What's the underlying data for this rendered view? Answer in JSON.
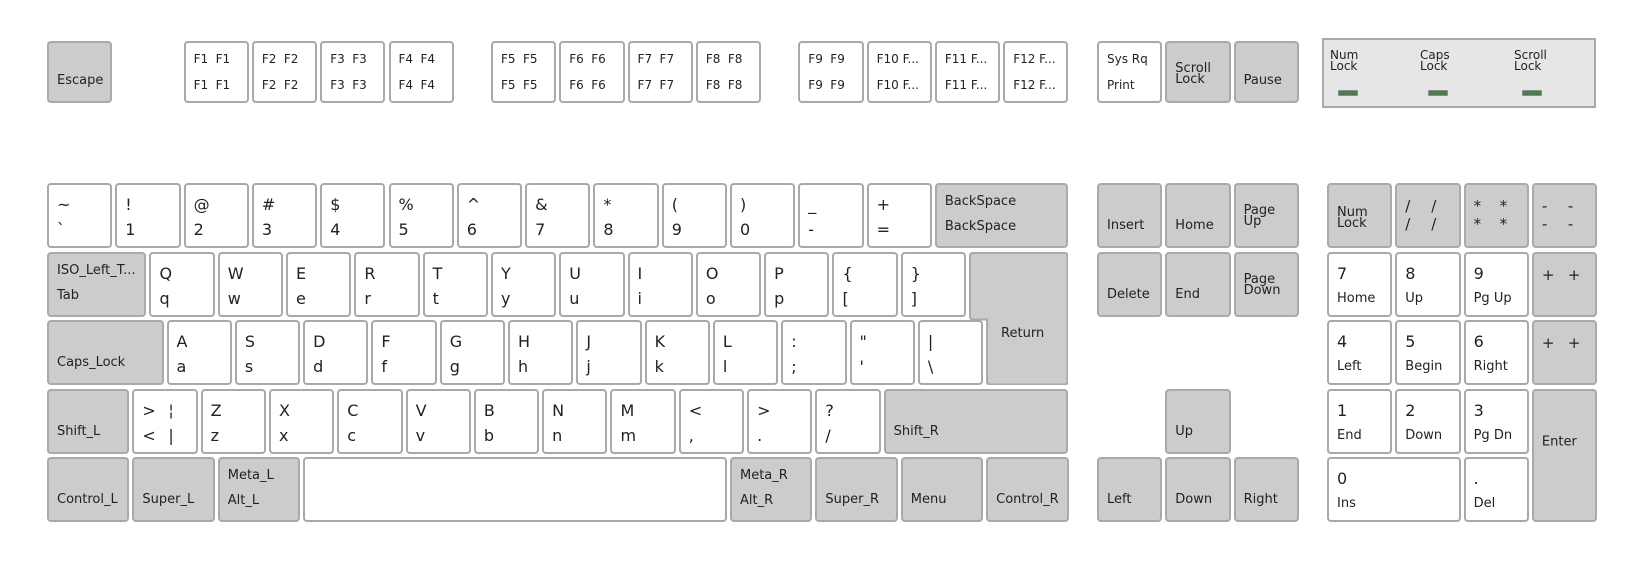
{
  "leds": [
    {
      "label": "Num\nLock",
      "state": "off",
      "color": "#4f7a4f"
    },
    {
      "label": "Caps\nLock",
      "state": "off",
      "color": "#4f7a4f"
    },
    {
      "label": "Scroll\nLock",
      "state": "off",
      "color": "#4f7a4f"
    }
  ],
  "function_row": [
    {
      "id": "escape",
      "style": "mod",
      "labels": {
        "single": "Escape"
      }
    },
    {
      "id": "f1",
      "style": "fkey",
      "labels": {
        "tl": "F1",
        "tr": "F1",
        "bl": "F1",
        "br": "F1"
      }
    },
    {
      "id": "f2",
      "style": "fkey",
      "labels": {
        "tl": "F2",
        "tr": "F2",
        "bl": "F2",
        "br": "F2"
      }
    },
    {
      "id": "f3",
      "style": "fkey",
      "labels": {
        "tl": "F3",
        "tr": "F3",
        "bl": "F3",
        "br": "F3"
      }
    },
    {
      "id": "f4",
      "style": "fkey",
      "labels": {
        "tl": "F4",
        "tr": "F4",
        "bl": "F4",
        "br": "F4"
      }
    },
    {
      "id": "f5",
      "style": "fkey",
      "labels": {
        "tl": "F5",
        "tr": "F5",
        "bl": "F5",
        "br": "F5"
      }
    },
    {
      "id": "f6",
      "style": "fkey",
      "labels": {
        "tl": "F6",
        "tr": "F6",
        "bl": "F6",
        "br": "F6"
      }
    },
    {
      "id": "f7",
      "style": "fkey",
      "labels": {
        "tl": "F7",
        "tr": "F7",
        "bl": "F7",
        "br": "F7"
      }
    },
    {
      "id": "f8",
      "style": "fkey",
      "labels": {
        "tl": "F8",
        "tr": "F8",
        "bl": "F8",
        "br": "F8"
      }
    },
    {
      "id": "f9",
      "style": "fkey",
      "labels": {
        "tl": "F9",
        "tr": "F9",
        "bl": "F9",
        "br": "F9"
      }
    },
    {
      "id": "f10",
      "style": "fkey",
      "labels": {
        "tl": "F10 F...",
        "bl": "F10 F..."
      }
    },
    {
      "id": "f11",
      "style": "fkey",
      "labels": {
        "tl": "F11 F...",
        "bl": "F11 F..."
      }
    },
    {
      "id": "f12",
      "style": "fkey",
      "labels": {
        "tl": "F12 F...",
        "bl": "F12 F..."
      }
    },
    {
      "id": "sysrq",
      "style": "fkey",
      "labels": {
        "tl": "Sys Rq",
        "bl": "Print"
      }
    },
    {
      "id": "scrolllock",
      "style": "fkey",
      "labels": {
        "stack": "Scroll\nLock"
      }
    },
    {
      "id": "pause",
      "style": "fkey",
      "labels": {
        "single": "Pause"
      }
    }
  ],
  "number_row": [
    {
      "id": "grave",
      "labels": {
        "tl": "~",
        "bl": "`"
      }
    },
    {
      "id": "1",
      "labels": {
        "tl": "!",
        "bl": "1"
      }
    },
    {
      "id": "2",
      "labels": {
        "tl": "@",
        "bl": "2"
      }
    },
    {
      "id": "3",
      "labels": {
        "tl": "#",
        "bl": "3"
      }
    },
    {
      "id": "4",
      "labels": {
        "tl": "$",
        "bl": "4"
      }
    },
    {
      "id": "5",
      "labels": {
        "tl": "%",
        "bl": "5"
      }
    },
    {
      "id": "6",
      "labels": {
        "tl": "^",
        "bl": "6"
      }
    },
    {
      "id": "7",
      "labels": {
        "tl": "&",
        "bl": "7"
      }
    },
    {
      "id": "8",
      "labels": {
        "tl": "*",
        "bl": "8"
      }
    },
    {
      "id": "9",
      "labels": {
        "tl": "(",
        "bl": "9"
      }
    },
    {
      "id": "0",
      "labels": {
        "tl": ")",
        "bl": "0"
      }
    },
    {
      "id": "minus",
      "labels": {
        "tl": "_",
        "bl": "-"
      }
    },
    {
      "id": "equal",
      "labels": {
        "tl": "+",
        "bl": "="
      }
    },
    {
      "id": "backspace",
      "style": "mod",
      "labels": {
        "two_top": "BackSpace",
        "two_bot": "BackSpace"
      }
    }
  ],
  "top_row": [
    {
      "id": "tab",
      "style": "mod",
      "labels": {
        "two_top": "ISO_Left_T...",
        "two_bot": "Tab"
      }
    },
    {
      "id": "q",
      "labels": {
        "tl": "Q",
        "bl": "q"
      }
    },
    {
      "id": "w",
      "labels": {
        "tl": "W",
        "bl": "w"
      }
    },
    {
      "id": "e",
      "labels": {
        "tl": "E",
        "bl": "e"
      }
    },
    {
      "id": "r",
      "labels": {
        "tl": "R",
        "bl": "r"
      }
    },
    {
      "id": "t",
      "labels": {
        "tl": "T",
        "bl": "t"
      }
    },
    {
      "id": "y",
      "labels": {
        "tl": "Y",
        "bl": "y"
      }
    },
    {
      "id": "u",
      "labels": {
        "tl": "U",
        "bl": "u"
      }
    },
    {
      "id": "i",
      "labels": {
        "tl": "I",
        "bl": "i"
      }
    },
    {
      "id": "o",
      "labels": {
        "tl": "O",
        "bl": "o"
      }
    },
    {
      "id": "p",
      "labels": {
        "tl": "P",
        "bl": "p"
      }
    },
    {
      "id": "bracketleft",
      "labels": {
        "tl": "{",
        "bl": "["
      }
    },
    {
      "id": "bracketright",
      "labels": {
        "tl": "}",
        "bl": "]"
      }
    }
  ],
  "return_key": {
    "label": "Return"
  },
  "home_row": [
    {
      "id": "capslock",
      "style": "mod",
      "labels": {
        "single": "Caps_Lock"
      }
    },
    {
      "id": "a",
      "labels": {
        "tl": "A",
        "bl": "a"
      }
    },
    {
      "id": "s",
      "labels": {
        "tl": "S",
        "bl": "s"
      }
    },
    {
      "id": "d",
      "labels": {
        "tl": "D",
        "bl": "d"
      }
    },
    {
      "id": "f",
      "labels": {
        "tl": "F",
        "bl": "f"
      }
    },
    {
      "id": "g",
      "labels": {
        "tl": "G",
        "bl": "g"
      }
    },
    {
      "id": "h",
      "labels": {
        "tl": "H",
        "bl": "h"
      }
    },
    {
      "id": "j",
      "labels": {
        "tl": "J",
        "bl": "j"
      }
    },
    {
      "id": "k",
      "labels": {
        "tl": "K",
        "bl": "k"
      }
    },
    {
      "id": "l",
      "labels": {
        "tl": "L",
        "bl": "l"
      }
    },
    {
      "id": "semicolon",
      "labels": {
        "tl": ":",
        "bl": ";"
      }
    },
    {
      "id": "apostrophe",
      "labels": {
        "tl": "\"",
        "bl": "'"
      }
    },
    {
      "id": "backslash",
      "labels": {
        "tl": "|",
        "bl": "\\"
      }
    }
  ],
  "bottom_row": [
    {
      "id": "shift_l",
      "style": "mod",
      "labels": {
        "single": "Shift_L"
      }
    },
    {
      "id": "less",
      "labels": {
        "tl": ">",
        "tr": "¦",
        "bl": "<",
        "br": "|"
      }
    },
    {
      "id": "z",
      "labels": {
        "tl": "Z",
        "bl": "z"
      }
    },
    {
      "id": "x",
      "labels": {
        "tl": "X",
        "bl": "x"
      }
    },
    {
      "id": "c",
      "labels": {
        "tl": "C",
        "bl": "c"
      }
    },
    {
      "id": "v",
      "labels": {
        "tl": "V",
        "bl": "v"
      }
    },
    {
      "id": "b",
      "labels": {
        "tl": "B",
        "bl": "b"
      }
    },
    {
      "id": "n",
      "labels": {
        "tl": "N",
        "bl": "n"
      }
    },
    {
      "id": "m",
      "labels": {
        "tl": "M",
        "bl": "m"
      }
    },
    {
      "id": "comma",
      "labels": {
        "tl": "<",
        "bl": ","
      }
    },
    {
      "id": "period",
      "labels": {
        "tl": ">",
        "bl": "."
      }
    },
    {
      "id": "slash",
      "labels": {
        "tl": "?",
        "bl": "/"
      }
    },
    {
      "id": "shift_r",
      "style": "mod",
      "labels": {
        "single": "Shift_R"
      }
    }
  ],
  "space_row": [
    {
      "id": "control_l",
      "style": "mod",
      "labels": {
        "single": "Control_L"
      }
    },
    {
      "id": "super_l",
      "style": "mod",
      "labels": {
        "single": "Super_L"
      }
    },
    {
      "id": "alt_l",
      "style": "mod",
      "labels": {
        "two_top": "Meta_L",
        "two_bot": "Alt_L"
      }
    },
    {
      "id": "space",
      "style": "space",
      "labels": {}
    },
    {
      "id": "alt_r",
      "style": "mod",
      "labels": {
        "two_top": "Meta_R",
        "two_bot": "Alt_R"
      }
    },
    {
      "id": "super_r",
      "style": "mod",
      "labels": {
        "single": "Super_R"
      }
    },
    {
      "id": "menu",
      "style": "mod",
      "labels": {
        "single": "Menu"
      }
    },
    {
      "id": "control_r",
      "style": "mod",
      "labels": {
        "single": "Control_R"
      }
    }
  ],
  "nav_block": [
    {
      "id": "insert",
      "labels": {
        "single": "Insert"
      }
    },
    {
      "id": "home",
      "labels": {
        "single": "Home"
      }
    },
    {
      "id": "pageup",
      "labels": {
        "stack": "Page\nUp"
      }
    },
    {
      "id": "delete",
      "labels": {
        "single": "Delete"
      }
    },
    {
      "id": "end",
      "labels": {
        "single": "End"
      }
    },
    {
      "id": "pagedown",
      "labels": {
        "stack": "Page\nDown"
      }
    },
    {
      "id": "up",
      "labels": {
        "single": "Up"
      }
    },
    {
      "id": "left",
      "labels": {
        "single": "Left"
      }
    },
    {
      "id": "down",
      "labels": {
        "single": "Down"
      }
    },
    {
      "id": "right",
      "labels": {
        "single": "Right"
      }
    }
  ],
  "numpad": [
    {
      "id": "numlock",
      "style": "mod",
      "labels": {
        "stack": "Num\nLock"
      }
    },
    {
      "id": "kp_divide",
      "style": "mod",
      "labels": {
        "tl": "/",
        "tr": "/",
        "bl": "/",
        "br": "/"
      }
    },
    {
      "id": "kp_multiply",
      "style": "mod",
      "labels": {
        "tl": "*",
        "tr": "*",
        "bl": "*",
        "br": "*"
      }
    },
    {
      "id": "kp_subtract",
      "style": "mod",
      "labels": {
        "tl": "-",
        "tr": "-",
        "bl": "-",
        "br": "-"
      }
    },
    {
      "id": "kp_7",
      "style": "np",
      "labels": {
        "big": "7",
        "small": "Home"
      }
    },
    {
      "id": "kp_8",
      "style": "np",
      "labels": {
        "big": "8",
        "small": "Up"
      }
    },
    {
      "id": "kp_9",
      "style": "np",
      "labels": {
        "big": "9",
        "small": "Pg Up"
      }
    },
    {
      "id": "kp_add_top",
      "style": "mod",
      "labels": {
        "tl": "+",
        "tr": "+"
      }
    },
    {
      "id": "kp_4",
      "style": "np",
      "labels": {
        "big": "4",
        "small": "Left"
      }
    },
    {
      "id": "kp_5",
      "style": "np",
      "labels": {
        "big": "5",
        "small": "Begin"
      }
    },
    {
      "id": "kp_6",
      "style": "np",
      "labels": {
        "big": "6",
        "small": "Right"
      }
    },
    {
      "id": "kp_add_bot",
      "style": "mod",
      "labels": {
        "tl": "+",
        "tr": "+"
      }
    },
    {
      "id": "kp_1",
      "style": "np",
      "labels": {
        "big": "1",
        "small": "End"
      }
    },
    {
      "id": "kp_2",
      "style": "np",
      "labels": {
        "big": "2",
        "small": "Down"
      }
    },
    {
      "id": "kp_3",
      "style": "np",
      "labels": {
        "big": "3",
        "small": "Pg Dn"
      }
    },
    {
      "id": "kp_enter",
      "style": "mod",
      "labels": {
        "mid": "Enter"
      }
    },
    {
      "id": "kp_0",
      "style": "np",
      "labels": {
        "big": "0",
        "small": "Ins"
      }
    },
    {
      "id": "kp_decimal",
      "style": "np",
      "labels": {
        "big": ".",
        "small": "Del"
      }
    }
  ]
}
